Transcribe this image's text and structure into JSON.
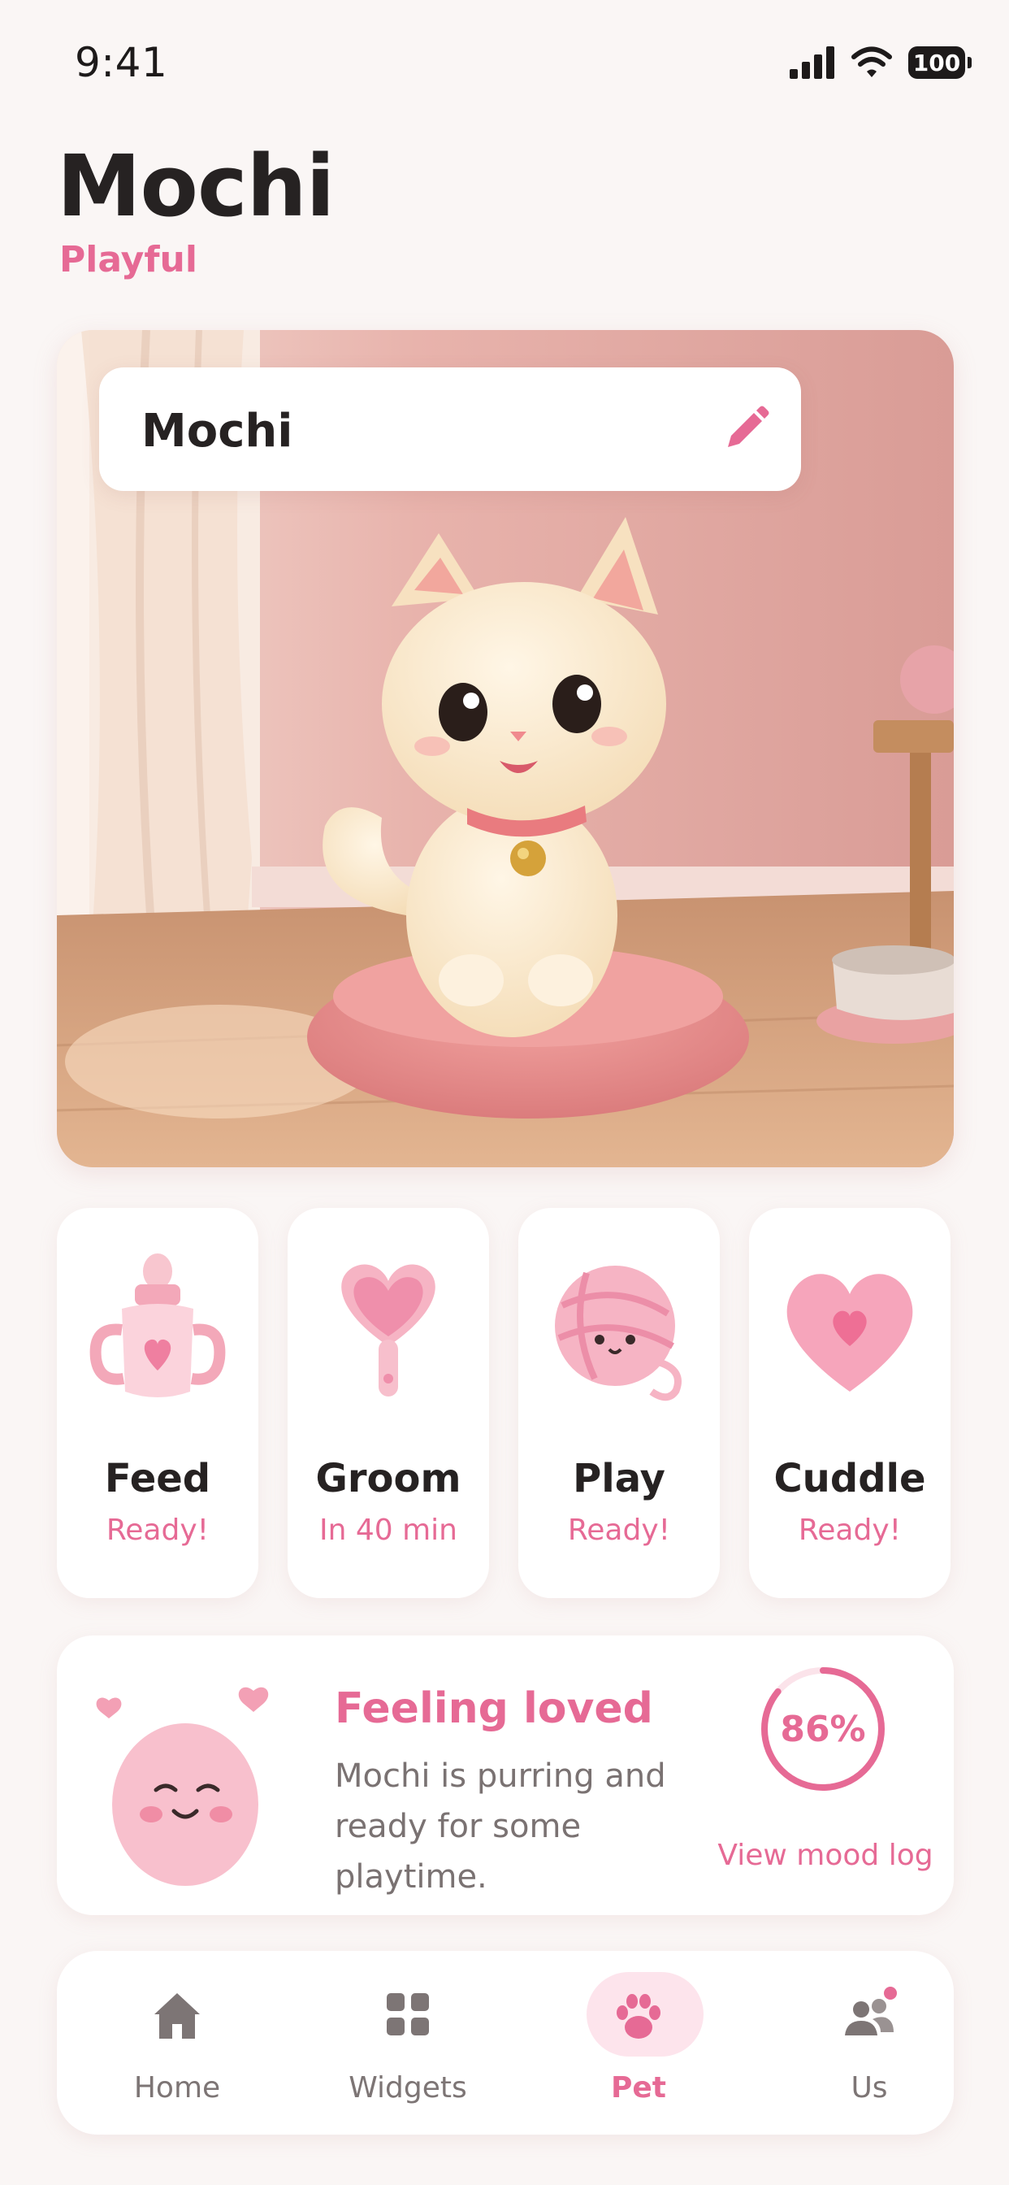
{
  "status_bar": {
    "time": "9:41",
    "battery": "100"
  },
  "header": {
    "title": "Mochi",
    "subtitle": "Playful"
  },
  "hero": {
    "pet_name": "Mochi"
  },
  "actions": [
    {
      "label": "Feed",
      "status": "Ready!",
      "icon": "bottle-icon"
    },
    {
      "label": "Groom",
      "status": "In 40 min",
      "icon": "brush-icon"
    },
    {
      "label": "Play",
      "status": "Ready!",
      "icon": "yarn-ball-icon"
    },
    {
      "label": "Cuddle",
      "status": "Ready!",
      "icon": "heart-pillow-icon"
    }
  ],
  "mood": {
    "title": "Feeling loved",
    "description": "Mochi is purring and ready for some playtime.",
    "percent_label": "86%",
    "percent_value": 0.86,
    "log_link": "View mood log"
  },
  "tabs": [
    {
      "label": "Home",
      "icon": "home-icon"
    },
    {
      "label": "Widgets",
      "icon": "widgets-icon"
    },
    {
      "label": "Pet",
      "icon": "paw-icon",
      "active": true
    },
    {
      "label": "Us",
      "icon": "people-icon"
    }
  ],
  "colors": {
    "accent": "#e66a95",
    "background": "#faf6f5",
    "card": "#ffffff"
  }
}
